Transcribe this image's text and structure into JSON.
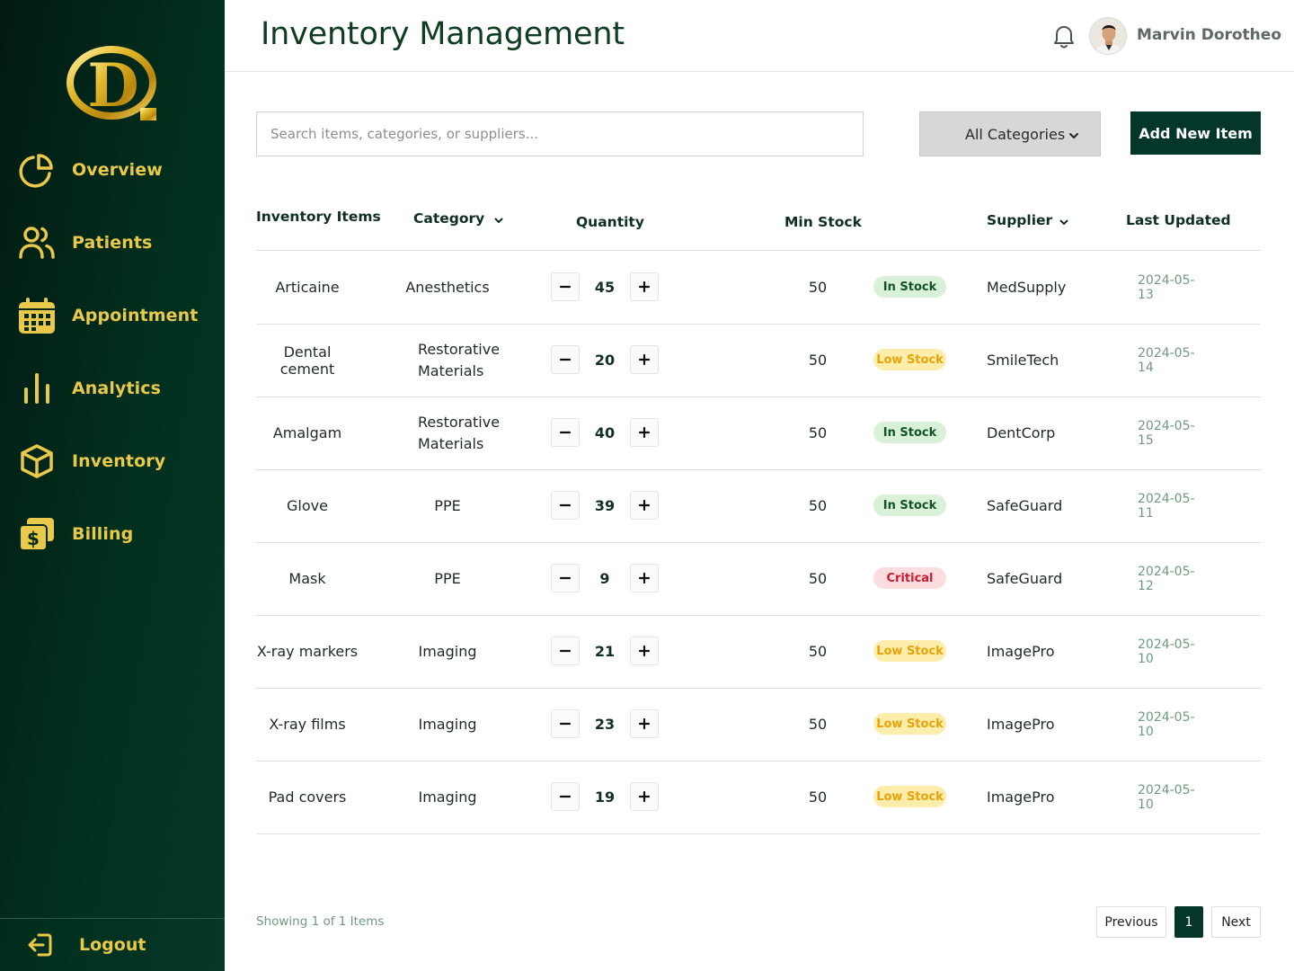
{
  "sidebar": {
    "logo_letter": "D",
    "items": [
      {
        "label": "Overview",
        "icon": "pie-chart-icon"
      },
      {
        "label": "Patients",
        "icon": "users-icon"
      },
      {
        "label": "Appointment",
        "icon": "calendar-icon"
      },
      {
        "label": "Analytics",
        "icon": "bar-chart-icon"
      },
      {
        "label": "Inventory",
        "icon": "box-icon"
      },
      {
        "label": "Billing",
        "icon": "dollar-card-icon"
      }
    ],
    "logout_label": "Logout"
  },
  "header": {
    "title": "Inventory Management",
    "user_name": "Marvin Dorotheo"
  },
  "toolbar": {
    "search_placeholder": "Search items, categories, or suppliers...",
    "category_filter": "All Categories",
    "add_button": "Add New Item"
  },
  "table": {
    "columns": {
      "item": "Inventory Items",
      "category": "Category",
      "quantity": "Quantity",
      "min_stock": "Min Stock",
      "supplier": "Supplier",
      "updated": "Last Updated"
    },
    "rows": [
      {
        "name": "Articaine",
        "category": "Anesthetics",
        "quantity": "45",
        "min_stock": "50",
        "status": "In Stock",
        "status_type": "ok",
        "supplier": "MedSupply",
        "updated": "2024-05-13"
      },
      {
        "name": "Dental cement",
        "category": "Restorative Materials",
        "quantity": "20",
        "min_stock": "50",
        "status": "Low Stock",
        "status_type": "low",
        "supplier": "SmileTech",
        "updated": "2024-05-14"
      },
      {
        "name": "Amalgam",
        "category": "Restorative Materials",
        "quantity": "40",
        "min_stock": "50",
        "status": "In Stock",
        "status_type": "ok",
        "supplier": "DentCorp",
        "updated": "2024-05-15"
      },
      {
        "name": "Glove",
        "category": "PPE",
        "quantity": "39",
        "min_stock": "50",
        "status": "In Stock",
        "status_type": "ok",
        "supplier": "SafeGuard",
        "updated": "2024-05-11"
      },
      {
        "name": "Mask",
        "category": "PPE",
        "quantity": "9",
        "min_stock": "50",
        "status": "Critical",
        "status_type": "crit",
        "supplier": "SafeGuard",
        "updated": "2024-05-12"
      },
      {
        "name": "X-ray markers",
        "category": "Imaging",
        "quantity": "21",
        "min_stock": "50",
        "status": "Low Stock",
        "status_type": "low",
        "supplier": "ImagePro",
        "updated": "2024-05-10"
      },
      {
        "name": "X-ray films",
        "category": "Imaging",
        "quantity": "23",
        "min_stock": "50",
        "status": "Low Stock",
        "status_type": "low",
        "supplier": "ImagePro",
        "updated": "2024-05-10"
      },
      {
        "name": "Pad covers",
        "category": "Imaging",
        "quantity": "19",
        "min_stock": "50",
        "status": "Low Stock",
        "status_type": "low",
        "supplier": "ImagePro",
        "updated": "2024-05-10"
      }
    ]
  },
  "footer": {
    "showing": "Showing 1 of 1 Items",
    "previous": "Previous",
    "page": "1",
    "next": "Next"
  },
  "colors": {
    "sidebar_bg": "#02301f",
    "accent_gold": "#e9c84a",
    "primary_dark_green": "#04362a",
    "status_ok": "#145227",
    "status_low": "#e8a20a",
    "status_critical": "#d0192e"
  }
}
